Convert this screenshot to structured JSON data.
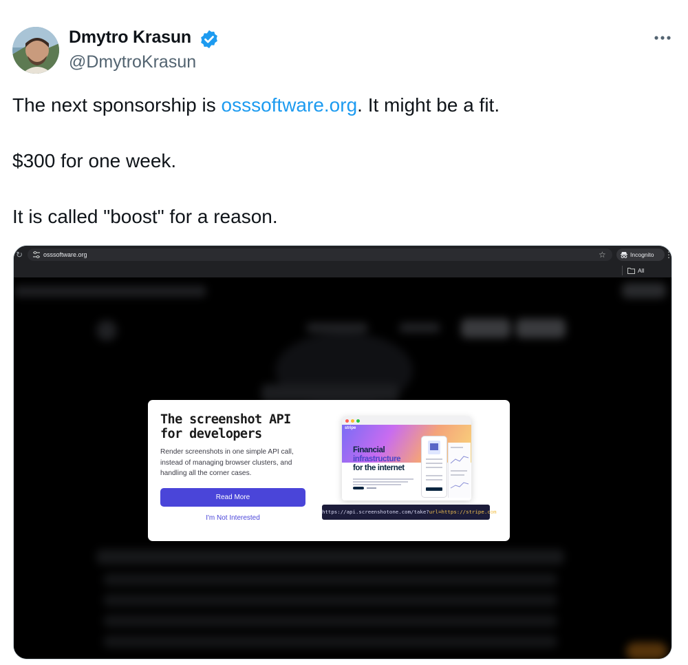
{
  "author": {
    "name": "Dmytro Krasun",
    "handle": "@DmytroKrasun",
    "verified": true
  },
  "tweet": {
    "line1_before": "The next sponsorship is ",
    "line1_link": "osssoftware.org",
    "line1_after": ". It might be a fit.",
    "line2": "$300 for one week.",
    "line3": "It is called \"boost\" for a reason."
  },
  "browser": {
    "url": "osssoftware.org",
    "incognito_label": "Incognito",
    "bookmarks_label": "All Bookmarks"
  },
  "ad": {
    "title_line1": "The screenshot API",
    "title_line2": "for developers",
    "description": "Render screenshots in one simple API call, instead of managing browser clusters, and handling all the corner cases.",
    "read_more": "Read More",
    "not_interested": "I'm Not Interested",
    "preview_logo": "stripe",
    "preview_headline_1": "Financial",
    "preview_headline_2": "infrastructure",
    "preview_headline_3": "for the internet",
    "api_url_prefix": "https://api.screenshotone.com/take?",
    "api_url_query": "url=https://stripe.com"
  },
  "colors": {
    "link": "#1d9bf0",
    "verified": "#1d9bf0",
    "ad_accent": "#4a45d9",
    "handle": "#536471"
  },
  "icons": [
    "verified-badge-icon",
    "more-options-icon",
    "reload-icon",
    "site-info-icon",
    "star-icon",
    "incognito-icon",
    "kebab-menu-icon",
    "folder-icon"
  ]
}
